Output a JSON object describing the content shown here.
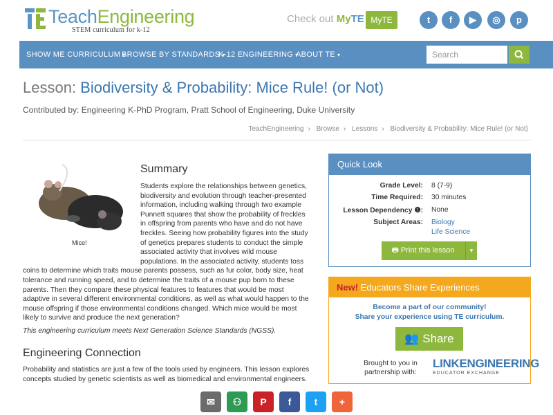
{
  "header": {
    "logo_teach": "Teach",
    "logo_eng": "Engineering",
    "logo_sub": "STEM curriculum for k-12",
    "checkout_text": "Check out ",
    "checkout_my": "My",
    "checkout_te": "TE",
    "myte_button": "MyTE",
    "social": [
      {
        "name": "twitter-icon",
        "glyph": "t",
        "color": "#5a8fc1"
      },
      {
        "name": "facebook-icon",
        "glyph": "f",
        "color": "#5a8fc1"
      },
      {
        "name": "youtube-icon",
        "glyph": "▶",
        "color": "#5a8fc1"
      },
      {
        "name": "instagram-icon",
        "glyph": "◎",
        "color": "#5a8fc1"
      },
      {
        "name": "pinterest-icon",
        "glyph": "p",
        "color": "#5a8fc1"
      }
    ]
  },
  "nav": {
    "items": [
      "SHOW ME CURRICULUM",
      "BROWSE BY STANDARDS",
      "K-12 ENGINEERING",
      "ABOUT TE"
    ],
    "search_placeholder": "Search"
  },
  "lesson": {
    "prefix": "Lesson: ",
    "title": "Biodiversity & Probability: Mice Rule! (or Not)",
    "contributed": "Contributed by: Engineering K-PhD Program, Pratt School of Engineering, Duke University"
  },
  "breadcrumb": [
    "TeachEngineering",
    "Browse",
    "Lessons",
    "Biodiversity & Probability: Mice Rule! (or Not)"
  ],
  "summary": {
    "heading": "Summary",
    "image_caption": "Mice!",
    "text": "Students explore the relationships between genetics, biodiversity and evolution through teacher-presented information, including walking through two example Punnett squares that show the probability of freckles in offspring from parents who have and do not have freckles. Seeing how probability figures into the study of genetics prepares students to conduct the simple associated activity that involves wild mouse populations. In the associated activity, students toss coins to determine which traits mouse parents possess, such as fur color, body size, heat tolerance and running speed, and to determine the traits of a mouse pup born to these parents. Then they compare these physical features to features that would be most adaptive in several different environmental conditions, as well as what would happen to the mouse offspring if those environmental conditions changed. Which mice would be most likely to survive and produce the next generation?",
    "ngss": "This engineering curriculum meets Next Generation Science Standards (NGSS)."
  },
  "engineering": {
    "heading": "Engineering Connection",
    "text": "Probability and statistics are just a few of the tools used by engineers. This lesson explores concepts studied by genetic scientists as well as biomedical and environmental engineers."
  },
  "quick_look": {
    "heading": "Quick Look",
    "grade_label": "Grade Level:",
    "grade_value": "8 (7-9)",
    "time_label": "Time Required:",
    "time_value": "30 minutes",
    "dep_label": "Lesson Dependency",
    "dep_value": "None",
    "subject_label": "Subject Areas:",
    "subject_1": "Biology",
    "subject_2": "Life Science",
    "print_label": "Print this lesson"
  },
  "share_box": {
    "new": "New!",
    "heading": " Educators Share Experiences",
    "line1": "Become a part of our community!",
    "line2": "Share your experience using TE curriculum.",
    "share_label": "Share",
    "brought_1": "Brought to you in",
    "brought_2": "partnership with:",
    "link_logo": "LINKENGINEERING",
    "link_sub": "EDUCATOR EXCHANGE"
  },
  "share_bar": [
    {
      "name": "email-share-icon",
      "glyph": "✉",
      "color": "#6b6b6b"
    },
    {
      "name": "classroom-share-icon",
      "glyph": "⚇",
      "color": "#2e9b55"
    },
    {
      "name": "pinterest-share-icon",
      "glyph": "P",
      "color": "#cb2127"
    },
    {
      "name": "facebook-share-icon",
      "glyph": "f",
      "color": "#3b5998"
    },
    {
      "name": "twitter-share-icon",
      "glyph": "t",
      "color": "#1da1f2"
    },
    {
      "name": "more-share-icon",
      "glyph": "+",
      "color": "#f0643a"
    }
  ]
}
